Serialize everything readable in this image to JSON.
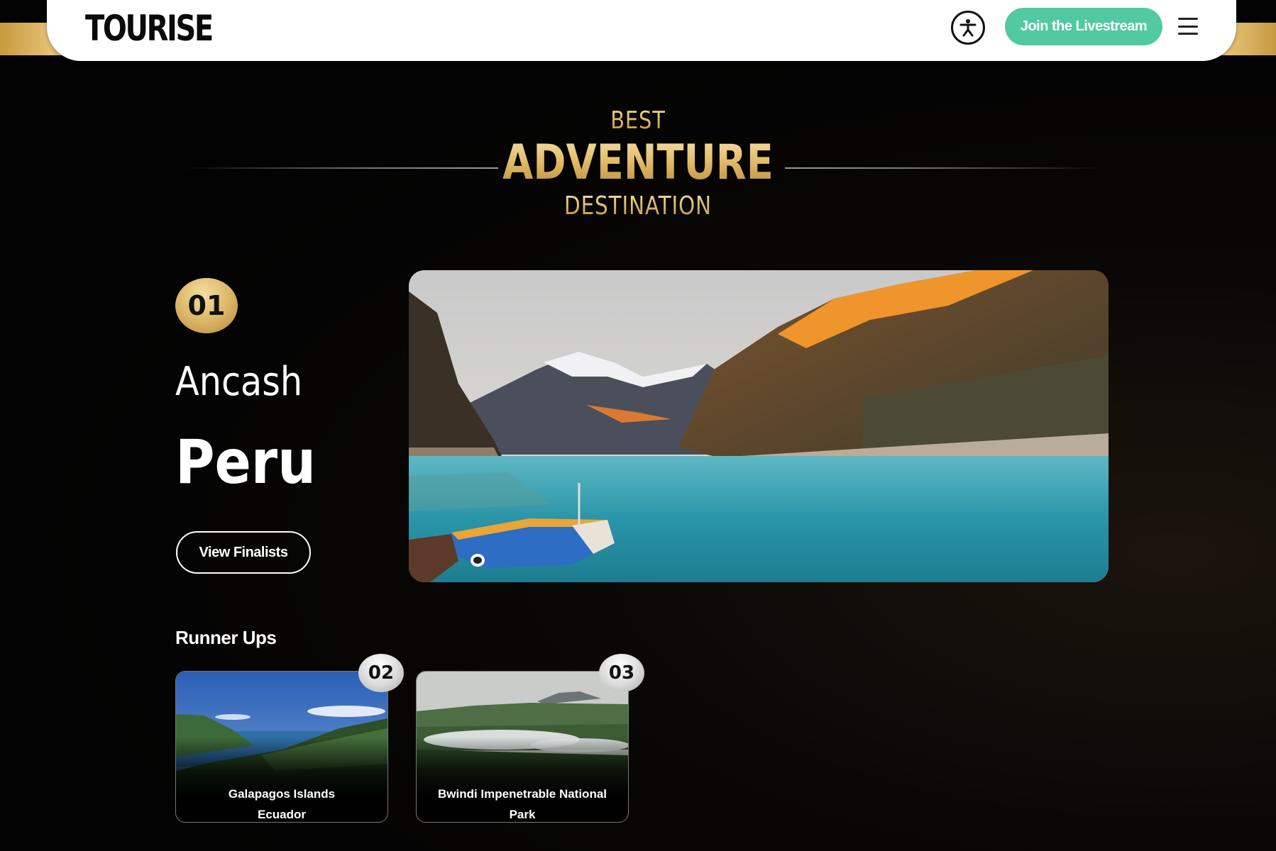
{
  "brand": {
    "logo_text": "TOURISE"
  },
  "navbar": {
    "accessibility_icon": "accessibility-icon",
    "livestream_label": "Join the Livestream",
    "menu_icon": "hamburger-menu-icon"
  },
  "colors": {
    "gold": "#d9b465",
    "livestream_green": "#52c9a0",
    "background": "#050505"
  },
  "heading": {
    "line1": "BEST",
    "line2": "ADVENTURE",
    "line3": "DESTINATION"
  },
  "winner": {
    "rank": "01",
    "region": "Ancash",
    "country": "Peru",
    "button_label": "View Finalists"
  },
  "runner_ups": {
    "title": "Runner Ups",
    "items": [
      {
        "rank": "02",
        "name": "Galapagos Islands",
        "country": "Ecuador"
      },
      {
        "rank": "03",
        "name": "Bwindi Impenetrable National Park",
        "country": ""
      }
    ]
  }
}
